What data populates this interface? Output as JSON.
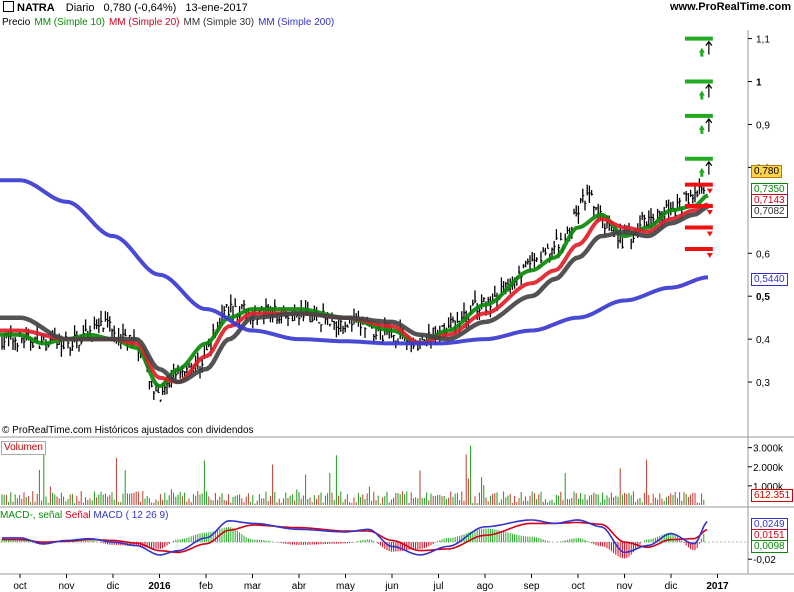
{
  "header": {
    "ticker": "NATRA",
    "period": "Diario",
    "quote": "0,780 (-0,64%)",
    "date": "13-ene-2017",
    "site": "www.ProRealTime.com"
  },
  "legend": {
    "price": "Precio",
    "mm10": "MM (Simple 10)",
    "mm20": "MM (Simple 20)",
    "mm30": "MM (Simple 30)",
    "mm200": "MM (Simple 200)"
  },
  "credit": "© ProRealTime.com  Históricos ajustados con dividendos",
  "volume_label": "Volumen",
  "macd_legend": {
    "macd_signal": "MACD-, señal",
    "signal": "Señal",
    "macd": "MACD ( 12 26 9)"
  },
  "tags": {
    "price": "0,780",
    "mm10": "0,7350",
    "mm20": "0,7143",
    "mm30": "0,7082",
    "mm200": "0,5440",
    "volume": "612.351",
    "macd": "0,0249",
    "signal": "0,0151",
    "hist": "0,0098"
  },
  "colors": {
    "price": "#000000",
    "mm10": "#0a8a0a",
    "mm20": "#e0202a",
    "mm30": "#444444",
    "mm200": "#3a3ad0",
    "target_green": "#22aa22",
    "level_red": "#ee1111",
    "price_tag_bg": "#ffd24d"
  },
  "chart_data": [
    {
      "type": "line",
      "panel": "price",
      "y_ticks": [
        "1,1",
        "1",
        "0,9",
        "0,8",
        "0,6",
        "0,5",
        "0,4",
        "0,3"
      ],
      "ylim": [
        0.2,
        1.12
      ],
      "x_ticks": [
        "oct",
        "nov",
        "dic",
        "2016",
        "feb",
        "mar",
        "abr",
        "may",
        "jun",
        "jul",
        "ago",
        "sep",
        "oct",
        "nov",
        "dic",
        "2017"
      ],
      "price_anchors": [
        [
          0,
          0.4
        ],
        [
          1,
          0.39
        ],
        [
          1.8,
          0.43
        ],
        [
          2.5,
          0.39
        ],
        [
          3,
          0.26
        ],
        [
          3.4,
          0.33
        ],
        [
          3.8,
          0.34
        ],
        [
          4.5,
          0.47
        ],
        [
          5,
          0.46
        ],
        [
          6,
          0.46
        ],
        [
          7,
          0.44
        ],
        [
          8,
          0.41
        ],
        [
          8.6,
          0.39
        ],
        [
          9.2,
          0.43
        ],
        [
          10,
          0.48
        ],
        [
          11,
          0.57
        ],
        [
          11.6,
          0.62
        ],
        [
          12.2,
          0.73
        ],
        [
          12.6,
          0.67
        ],
        [
          13,
          0.63
        ],
        [
          13.5,
          0.68
        ],
        [
          14,
          0.7
        ],
        [
          14.5,
          0.74
        ],
        [
          15.5,
          0.78
        ]
      ],
      "series": [
        {
          "name": "MM (Simple 10)",
          "anchors": [
            [
              0,
              0.41
            ],
            [
              0.5,
              0.39
            ],
            [
              1,
              0.4
            ],
            [
              1.5,
              0.41
            ],
            [
              2,
              0.4
            ],
            [
              2.5,
              0.38
            ],
            [
              3,
              0.29
            ],
            [
              3.4,
              0.33
            ],
            [
              4,
              0.39
            ],
            [
              4.5,
              0.45
            ],
            [
              5,
              0.47
            ],
            [
              6,
              0.47
            ],
            [
              7,
              0.45
            ],
            [
              8,
              0.42
            ],
            [
              8.6,
              0.39
            ],
            [
              9.2,
              0.42
            ],
            [
              10,
              0.48
            ],
            [
              11,
              0.56
            ],
            [
              11.5,
              0.59
            ],
            [
              12,
              0.66
            ],
            [
              12.5,
              0.69
            ],
            [
              13,
              0.64
            ],
            [
              13.5,
              0.66
            ],
            [
              14,
              0.7
            ],
            [
              14.5,
              0.71
            ],
            [
              14.8,
              0.735
            ]
          ]
        },
        {
          "name": "MM (Simple 20)",
          "anchors": [
            [
              0,
              0.42
            ],
            [
              1,
              0.4
            ],
            [
              2,
              0.4
            ],
            [
              2.5,
              0.39
            ],
            [
              3,
              0.31
            ],
            [
              3.4,
              0.3
            ],
            [
              4,
              0.36
            ],
            [
              4.5,
              0.43
            ],
            [
              5,
              0.46
            ],
            [
              6,
              0.46
            ],
            [
              7,
              0.45
            ],
            [
              8,
              0.43
            ],
            [
              8.6,
              0.39
            ],
            [
              9.2,
              0.41
            ],
            [
              10,
              0.46
            ],
            [
              11,
              0.53
            ],
            [
              11.5,
              0.56
            ],
            [
              12,
              0.62
            ],
            [
              12.5,
              0.68
            ],
            [
              13,
              0.66
            ],
            [
              13.5,
              0.65
            ],
            [
              14,
              0.68
            ],
            [
              14.5,
              0.7
            ],
            [
              14.8,
              0.714
            ]
          ]
        },
        {
          "name": "MM (Simple 30)",
          "anchors": [
            [
              0,
              0.45
            ],
            [
              1,
              0.4
            ],
            [
              2,
              0.4
            ],
            [
              2.5,
              0.4
            ],
            [
              3,
              0.33
            ],
            [
              3.4,
              0.3
            ],
            [
              4,
              0.33
            ],
            [
              4.5,
              0.4
            ],
            [
              5,
              0.45
            ],
            [
              6,
              0.46
            ],
            [
              7,
              0.45
            ],
            [
              8,
              0.44
            ],
            [
              8.6,
              0.41
            ],
            [
              9.2,
              0.4
            ],
            [
              10,
              0.44
            ],
            [
              11,
              0.5
            ],
            [
              11.5,
              0.54
            ],
            [
              12,
              0.59
            ],
            [
              12.5,
              0.64
            ],
            [
              13,
              0.65
            ],
            [
              13.5,
              0.64
            ],
            [
              14,
              0.67
            ],
            [
              14.5,
              0.69
            ],
            [
              14.8,
              0.708
            ]
          ]
        },
        {
          "name": "MM (Simple 200)",
          "anchors": [
            [
              0,
              0.77
            ],
            [
              1,
              0.72
            ],
            [
              2,
              0.64
            ],
            [
              3,
              0.55
            ],
            [
              4,
              0.47
            ],
            [
              5,
              0.42
            ],
            [
              6,
              0.4
            ],
            [
              7,
              0.395
            ],
            [
              8,
              0.39
            ],
            [
              9,
              0.39
            ],
            [
              10,
              0.4
            ],
            [
              11,
              0.42
            ],
            [
              12,
              0.45
            ],
            [
              13,
              0.49
            ],
            [
              14,
              0.52
            ],
            [
              14.8,
              0.544
            ]
          ]
        }
      ],
      "levels_green": [
        1.1,
        1.0,
        0.92,
        0.82
      ],
      "levels_red": [
        0.76,
        0.71,
        0.66,
        0.61
      ]
    },
    {
      "type": "bar",
      "panel": "volume",
      "y_ticks": [
        "3.000k",
        "2.000k",
        "1.000k"
      ],
      "ylim": [
        0,
        3400000
      ],
      "last_value": 612351
    },
    {
      "type": "line",
      "panel": "macd",
      "y_ticks": [
        "-0,02"
      ],
      "ylim": [
        -0.035,
        0.04
      ],
      "macd_anchors": [
        [
          0,
          0.005
        ],
        [
          0.5,
          -0.002
        ],
        [
          1,
          0.002
        ],
        [
          1.5,
          0.004
        ],
        [
          2,
          0.0
        ],
        [
          2.5,
          -0.004
        ],
        [
          3,
          -0.015
        ],
        [
          3.4,
          -0.01
        ],
        [
          4,
          0.005
        ],
        [
          4.5,
          0.025
        ],
        [
          5,
          0.022
        ],
        [
          6,
          0.015
        ],
        [
          7,
          0.012
        ],
        [
          7.5,
          0.015
        ],
        [
          8,
          -0.005
        ],
        [
          8.6,
          -0.015
        ],
        [
          9.2,
          -0.005
        ],
        [
          10,
          0.018
        ],
        [
          11,
          0.026
        ],
        [
          11.5,
          0.022
        ],
        [
          12,
          0.026
        ],
        [
          12.5,
          0.018
        ],
        [
          13,
          -0.012
        ],
        [
          13.5,
          -0.004
        ],
        [
          14,
          0.01
        ],
        [
          14.5,
          -0.002
        ],
        [
          14.8,
          0.0249
        ]
      ],
      "signal_anchors": [
        [
          0,
          0.003
        ],
        [
          0.5,
          0.0
        ],
        [
          1,
          0.001
        ],
        [
          1.5,
          0.003
        ],
        [
          2,
          0.002
        ],
        [
          2.5,
          -0.001
        ],
        [
          3,
          -0.01
        ],
        [
          3.4,
          -0.012
        ],
        [
          4,
          -0.002
        ],
        [
          4.5,
          0.014
        ],
        [
          5,
          0.02
        ],
        [
          6,
          0.017
        ],
        [
          7,
          0.013
        ],
        [
          7.5,
          0.013
        ],
        [
          8,
          0.002
        ],
        [
          8.6,
          -0.01
        ],
        [
          9.2,
          -0.008
        ],
        [
          10,
          0.008
        ],
        [
          11,
          0.022
        ],
        [
          11.5,
          0.022
        ],
        [
          12,
          0.023
        ],
        [
          12.5,
          0.021
        ],
        [
          13,
          0.0
        ],
        [
          13.5,
          -0.006
        ],
        [
          14,
          0.003
        ],
        [
          14.5,
          0.004
        ],
        [
          14.8,
          0.0151
        ]
      ]
    }
  ]
}
